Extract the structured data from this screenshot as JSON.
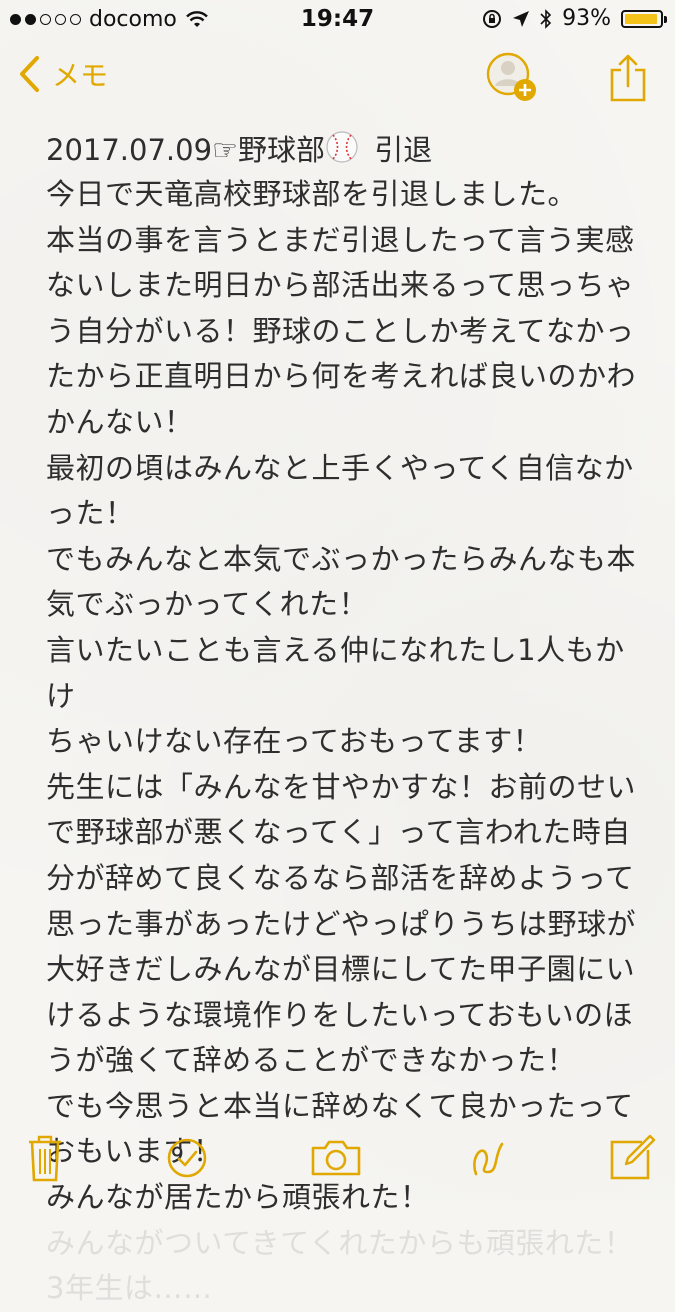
{
  "status_bar": {
    "carrier": "docomo",
    "signal_bars_filled": 2,
    "signal_bars_total": 5,
    "time": "19:47",
    "battery": "93%",
    "battery_level": 0.93,
    "icons": [
      "wifi-icon",
      "rotation-lock-icon",
      "location-arrow-icon",
      "bluetooth-icon",
      "battery-icon"
    ]
  },
  "nav": {
    "back_label": "メモ",
    "icons": [
      "chevron-left-icon",
      "add-person-icon",
      "share-icon"
    ]
  },
  "note": {
    "title": "2017.07.09☞野球部",
    "title_suffix": "引退",
    "lines": [
      "今日で天竜高校野球部を引退しました。",
      "本当の事を言うとまだ引退したって言う実感",
      "ないしまた明日から部活出来るって思っちゃ",
      "う自分がいる！野球のことしか考えてなかっ",
      "たから正直明日から何を考えれば良いのかわ",
      "かんない！",
      "最初の頃はみんなと上手くやってく自信なか",
      "った！",
      "でもみんなと本気でぶっかったらみんなも本",
      "気でぶっかってくれた！",
      "言いたいことも言える仲になれたし1人もかけ",
      "ちゃいけない存在っておもってます！",
      "先生には「みんなを甘やかすな！お前のせい",
      "で野球部が悪くなってく」って言われた時自",
      "分が辞めて良くなるなら部活を辞めようって",
      "思った事があったけどやっぱりうちは野球が",
      "大好きだしみんなが目標にしてた甲子園にい",
      "けるような環境作りをしたいっておもいのほ",
      "うが強くて辞めることができなかった！",
      "でも今思うと本当に辞めなくて良かったって",
      "おもいます！",
      "みんなが居たから頑張れた！"
    ],
    "faint_lines": [
      "みんながついてきてくれたからも頑張れた！",
      "3年生は……"
    ]
  },
  "toolbar": {
    "icons": [
      "trash-icon",
      "checklist-icon",
      "camera-icon",
      "sketch-icon",
      "compose-icon"
    ]
  },
  "colors": {
    "accent": "#e0a800",
    "text": "#2e2e2e",
    "background": "#f6f5f2"
  }
}
